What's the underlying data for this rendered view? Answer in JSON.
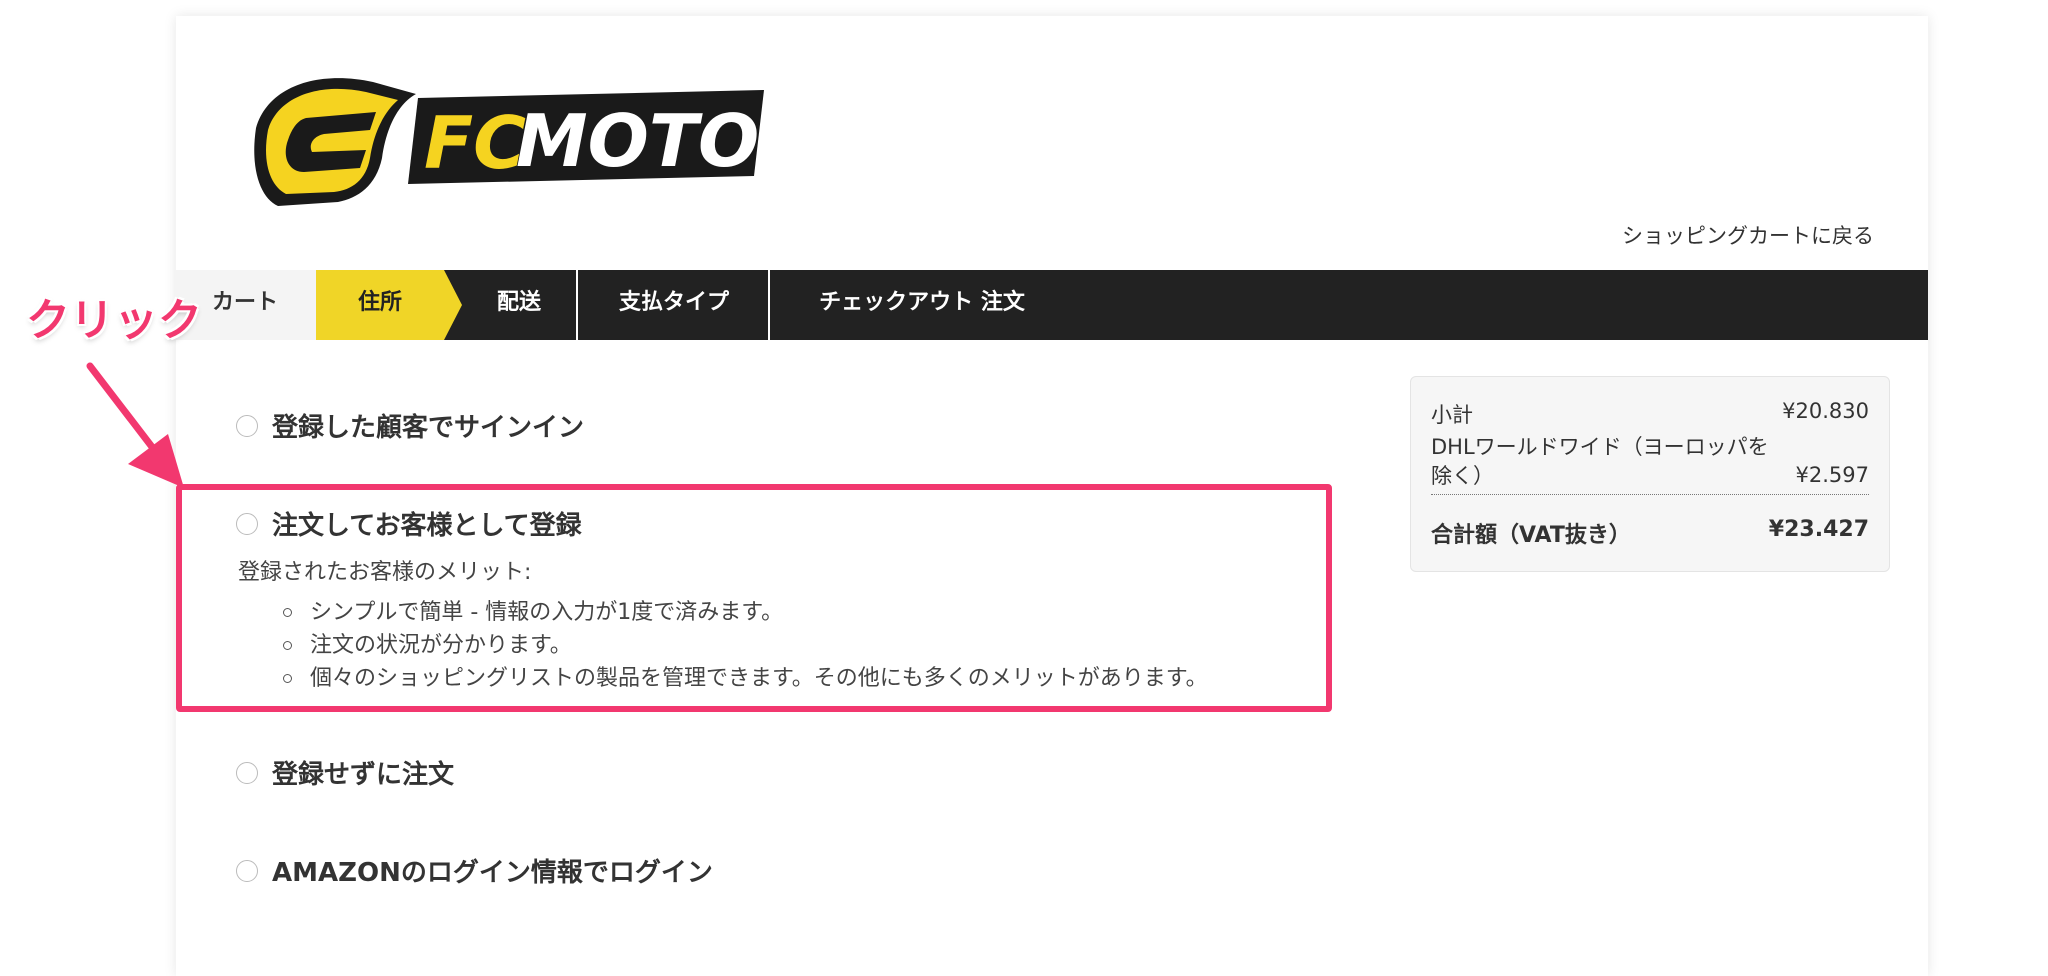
{
  "brand": {
    "logo_text_fc": "FC",
    "logo_text_moto": "MOTO",
    "logo_yellow": "#f5d320",
    "logo_black": "#1a1a1a"
  },
  "header": {
    "back_link": "ショッピングカートに戻る"
  },
  "steps": [
    {
      "label": "カート",
      "state": "done"
    },
    {
      "label": "住所",
      "state": "active"
    },
    {
      "label": "配送",
      "state": "pending"
    },
    {
      "label": "支払タイプ",
      "state": "pending"
    },
    {
      "label": "チェックアウト 注文",
      "state": "pending"
    }
  ],
  "options": [
    {
      "label": "登録した顧客でサインイン"
    },
    {
      "label": "注文してお客様として登録"
    },
    {
      "label": "登録せずに注文"
    },
    {
      "label": "AMAZONのログイン情報でログイン"
    }
  ],
  "benefits": {
    "title": "登録されたお客様のメリット:",
    "items": [
      "シンプルで簡単 - 情報の入力が1度で済みます。",
      "注文の状況が分かります。",
      "個々のショッピングリストの製品を管理できます。その他にも多くのメリットがあります。"
    ]
  },
  "annotation": {
    "text": "クリック",
    "color": "#f2386f"
  },
  "summary": {
    "subtotal_label": "小計",
    "subtotal_value": "¥20.830",
    "shipping_label": "DHLワールドワイド（ヨーロッパを除く）",
    "shipping_value": "¥2.597",
    "total_label": "合計額（VAT抜き）",
    "total_value": "¥23.427"
  },
  "colors": {
    "nav_bg": "#222222",
    "active_step": "#f0d527",
    "accent_pink": "#f2386f"
  }
}
